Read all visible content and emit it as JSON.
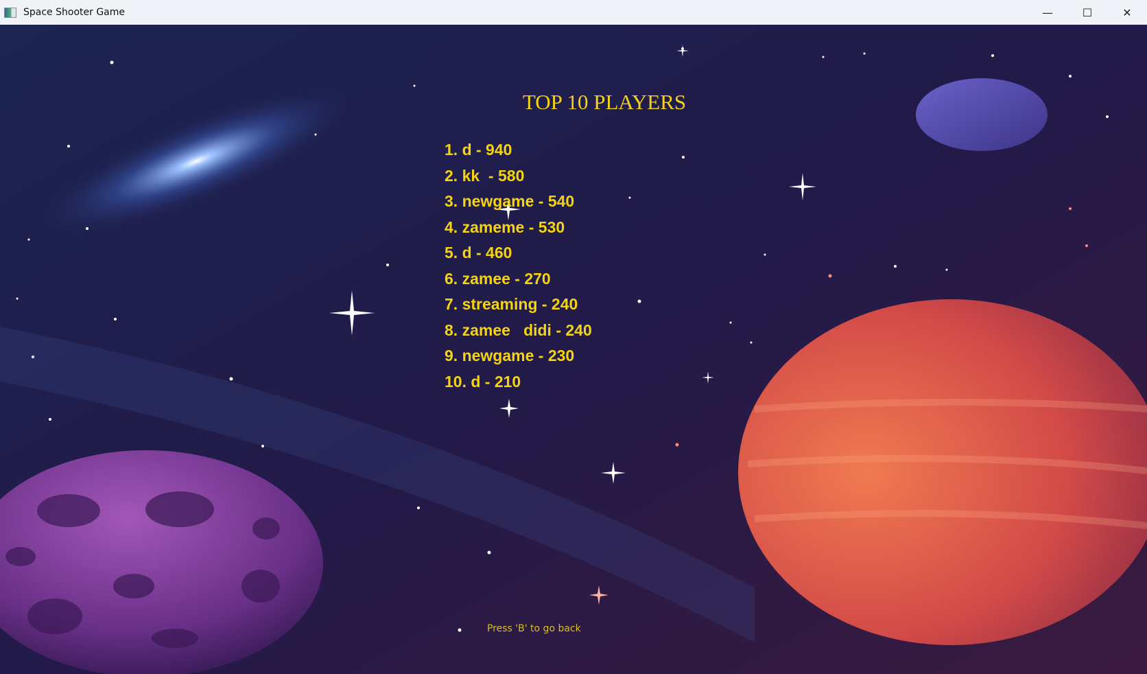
{
  "window": {
    "title": "Space Shooter Game",
    "minimize": "—",
    "maximize": "☐",
    "close": "✕"
  },
  "leaderboard": {
    "title": "TOP 10 PLAYERS",
    "entries": [
      "1. d - 940",
      "2. kk  - 580",
      "3. newgame - 540",
      "4. zameme - 530",
      "5. d - 460",
      "6. zamee - 270",
      "7. streaming - 240",
      "8. zamee   didi - 240",
      "9. newgame - 230",
      "10. d - 210"
    ]
  },
  "hint": "Press 'B' to go back",
  "colors": {
    "text": "#f4d313",
    "background": "#1a1640"
  }
}
